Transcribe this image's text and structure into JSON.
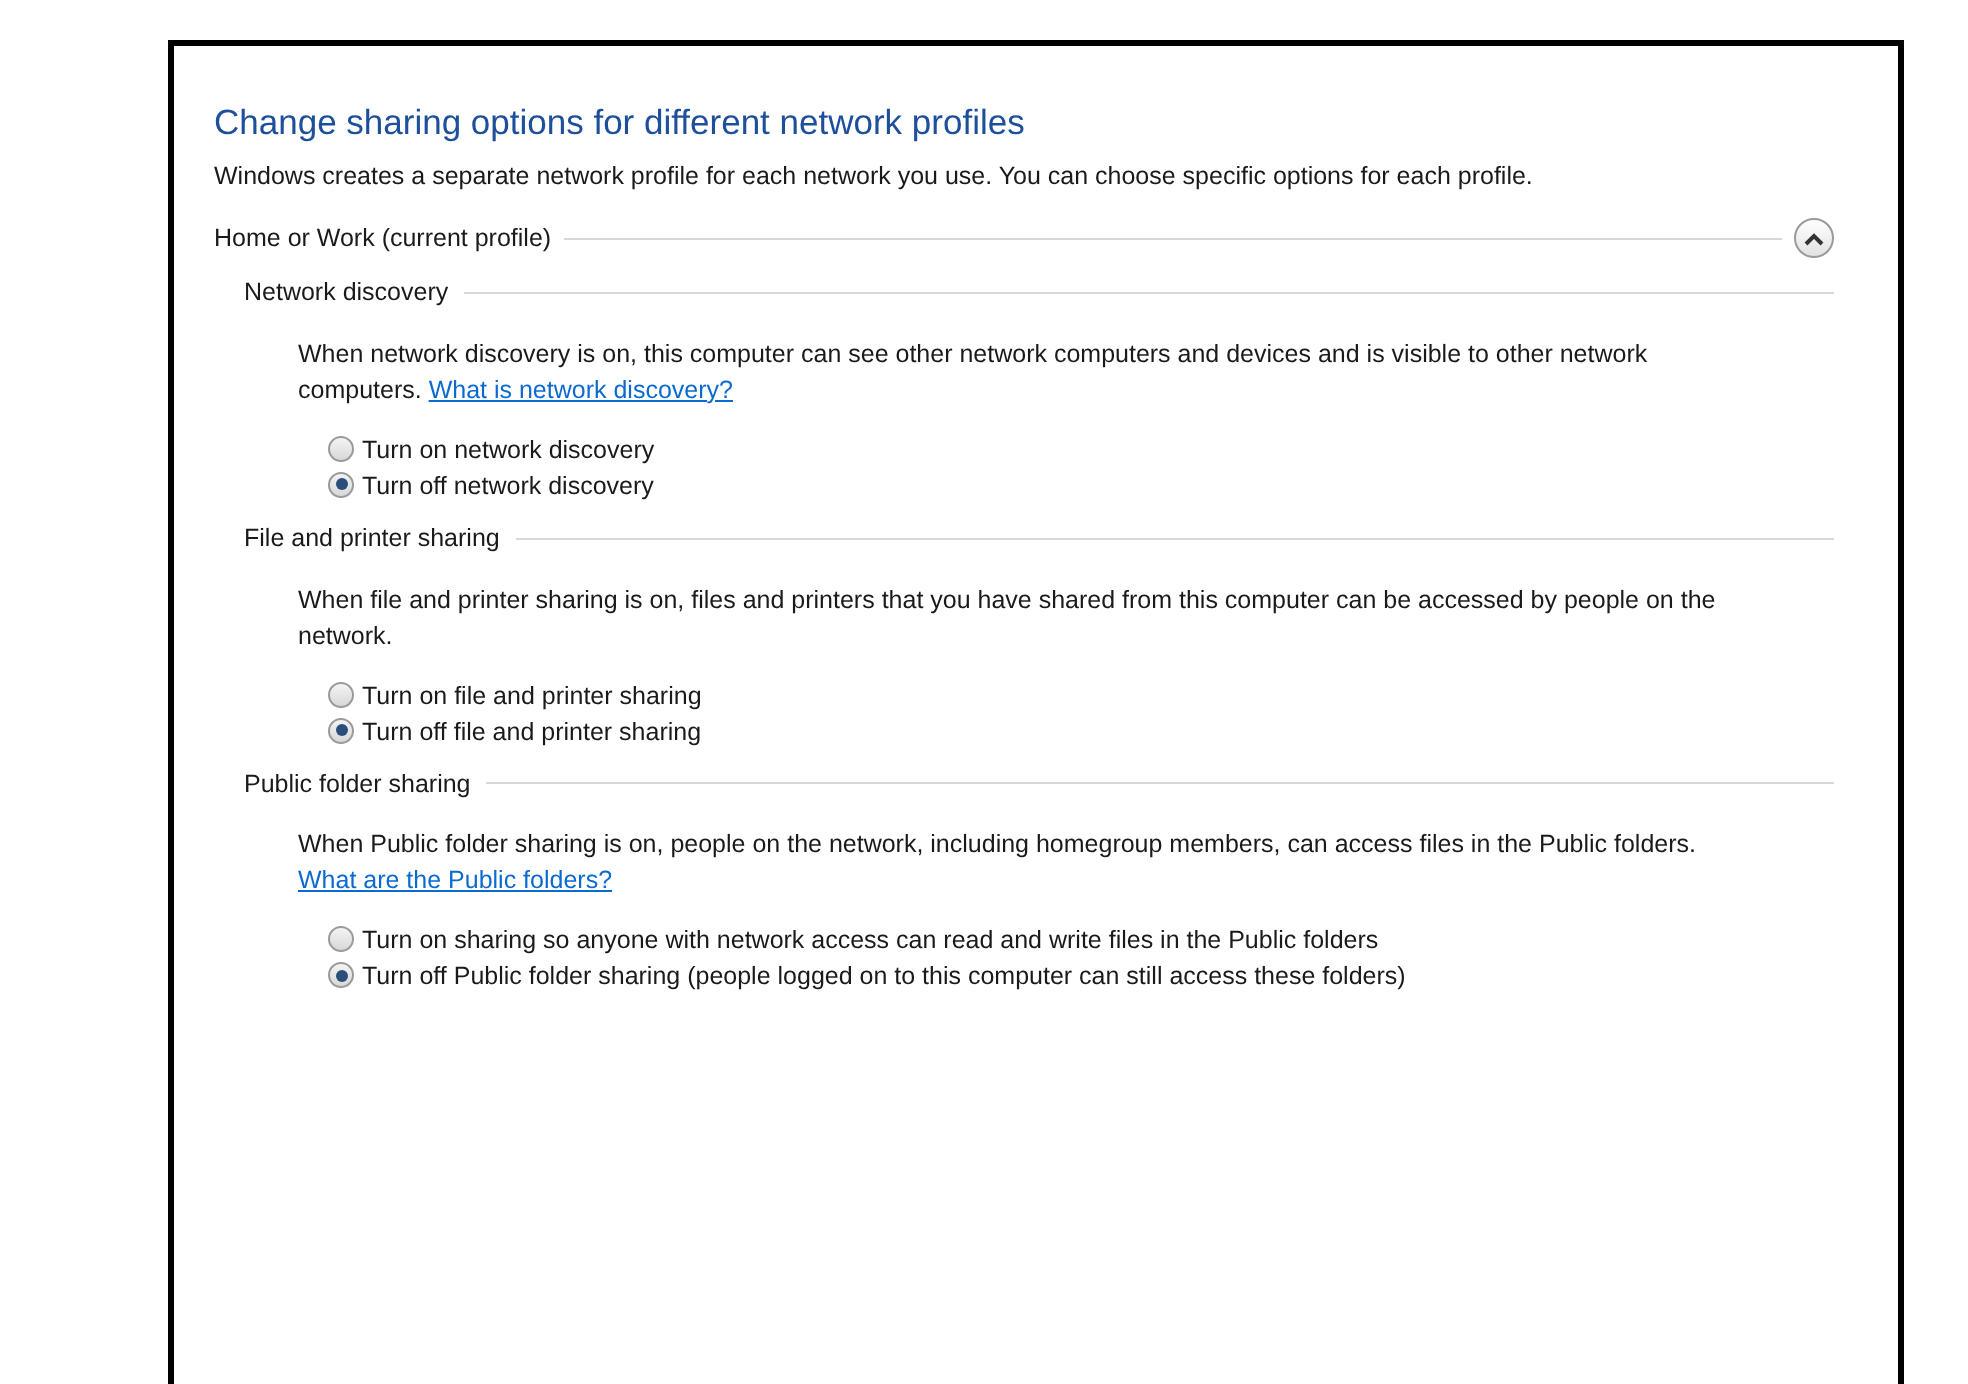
{
  "title": "Change sharing options for different network profiles",
  "intro": "Windows creates a separate network profile for each network you use. You can choose specific options for each profile.",
  "profile": {
    "label": "Home or Work (current profile)",
    "expanded": true,
    "sections": [
      {
        "heading": "Network discovery",
        "description": "When network discovery is on, this computer can see other network computers and devices and is visible to other network computers.",
        "link": "What is network discovery?",
        "options": [
          {
            "label": "Turn on network discovery",
            "selected": false
          },
          {
            "label": "Turn off network discovery",
            "selected": true
          }
        ]
      },
      {
        "heading": "File and printer sharing",
        "description": "When file and printer sharing is on, files and printers that you have shared from this computer can be accessed by people on the network.",
        "options": [
          {
            "label": "Turn on file and printer sharing",
            "selected": false
          },
          {
            "label": "Turn off file and printer sharing",
            "selected": true
          }
        ]
      },
      {
        "heading": "Public folder sharing",
        "description": "When Public folder sharing is on, people on the network, including homegroup members, can access files in the Public folders.",
        "link": "What are the Public folders?",
        "options": [
          {
            "label": "Turn on sharing so anyone with network access can read and write files in the Public folders",
            "selected": false
          },
          {
            "label": "Turn off Public folder sharing (people logged on to this computer can still access these folders)",
            "selected": true
          }
        ]
      }
    ]
  }
}
